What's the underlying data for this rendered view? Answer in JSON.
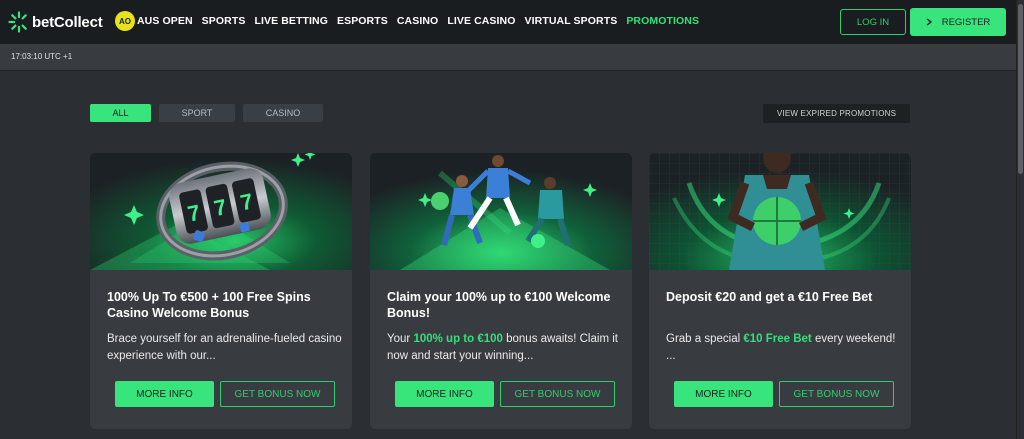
{
  "brand": {
    "name": "betCollect",
    "accent": "#38e57d",
    "background": "#2b2f33"
  },
  "nav": {
    "ao_badge": "AO",
    "links": [
      {
        "label": "AUS OPEN",
        "active": false
      },
      {
        "label": "SPORTS",
        "active": false
      },
      {
        "label": "LIVE BETTING",
        "active": false
      },
      {
        "label": "ESPORTS",
        "active": false
      },
      {
        "label": "CASINO",
        "active": false
      },
      {
        "label": "LIVE CASINO",
        "active": false
      },
      {
        "label": "VIRTUAL SPORTS",
        "active": false
      },
      {
        "label": "PROMOTIONS",
        "active": true
      }
    ],
    "login_label": "LOG IN",
    "register_label": "REGISTER",
    "register_icon": "chevron-right-icon"
  },
  "timebar": {
    "time": "17:03:10 UTC +1"
  },
  "filters": {
    "all": "ALL",
    "sport": "SPORT",
    "casino": "CASINO",
    "selected": "ALL",
    "view_expired": "VIEW EXPIRED PROMOTIONS"
  },
  "promotions": [
    {
      "image": "casino-slot-777-illustration",
      "title": "100% Up To €500 + 100 Free Spins Casino Welcome Bonus",
      "desc_before": "Brace yourself for an adrenaline-fueled casino experience with our...",
      "desc_highlight": "",
      "desc_after": "",
      "more_info": "MORE INFO",
      "get_bonus": "GET BONUS NOW"
    },
    {
      "image": "footballers-illustration",
      "title": "Claim your 100% up to €100 Welcome Bonus!",
      "desc_before": "Your ",
      "desc_highlight": "100% up to €100",
      "desc_after": " bonus awaits! Claim it now and start your winning...",
      "more_info": "MORE INFO",
      "get_bonus": "GET BONUS NOW"
    },
    {
      "image": "player-holding-ball-illustration",
      "title": "Deposit €20 and get a €10 Free Bet",
      "desc_before": "Grab a special ",
      "desc_highlight": "€10 Free Bet",
      "desc_after": " every weekend! ...",
      "more_info": "MORE INFO",
      "get_bonus": "GET BONUS NOW"
    }
  ]
}
